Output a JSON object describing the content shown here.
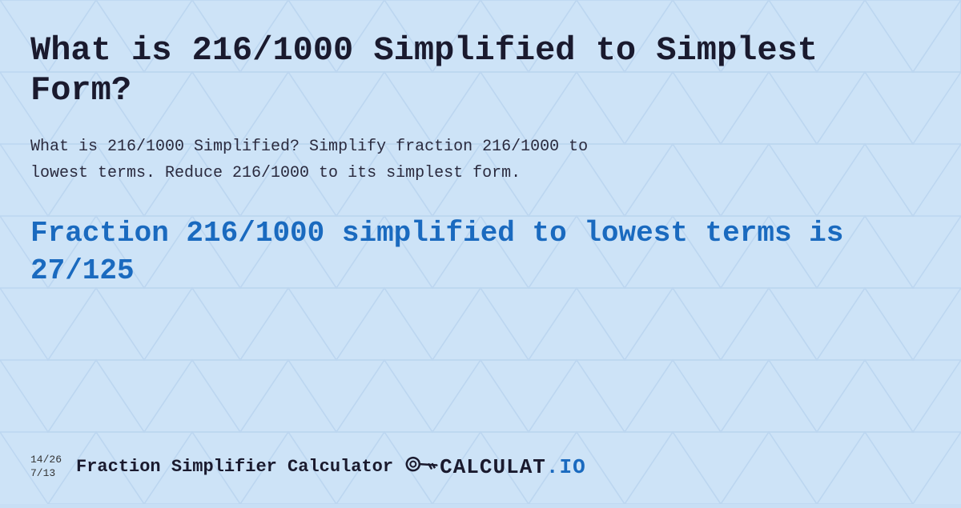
{
  "background": {
    "color": "#cde3f7"
  },
  "page": {
    "title": "What is 216/1000 Simplified to Simplest Form?",
    "description_line1": "What is 216/1000 Simplified? Simplify fraction 216/1000 to",
    "description_line2": "lowest terms. Reduce 216/1000 to its simplest form.",
    "result_line1": "Fraction 216/1000 simplified to lowest terms is",
    "result_line2": "27/125"
  },
  "footer": {
    "fraction1": "14/26",
    "fraction2": "7/13",
    "brand_label": "Fraction Simplifier Calculator",
    "logo_text_main": "CALCULAT",
    "logo_text_suffix": ".IO",
    "key_symbol": "🗝"
  }
}
